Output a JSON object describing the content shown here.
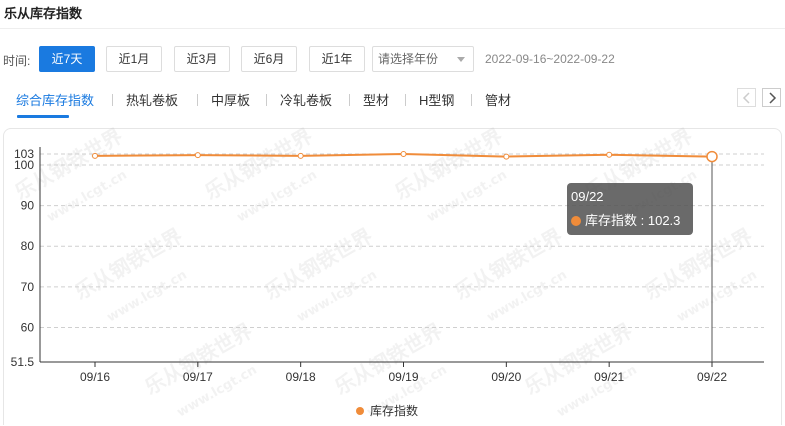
{
  "header": {
    "title": "乐从库存指数"
  },
  "time_filter": {
    "label": "时间:",
    "buttons": [
      "近7天",
      "近1月",
      "近3月",
      "近6月",
      "近1年"
    ],
    "active_index": 0,
    "year_placeholder": "请选择年份",
    "date_range": "2022-09-16~2022-09-22"
  },
  "tabs": {
    "items": [
      "综合库存指数",
      "热轧卷板",
      "中厚板",
      "冷轧卷板",
      "型材",
      "H型钢",
      "管材"
    ],
    "active_index": 0
  },
  "watermark": {
    "text": "乐从钢铁世界",
    "url": "www.lcgt.cn"
  },
  "tooltip": {
    "date": "09/22",
    "series": "库存指数",
    "value": "102.3"
  },
  "colors": {
    "accent": "#1a7ae0",
    "series": "#f08c3a"
  },
  "chart_data": {
    "type": "line",
    "categories": [
      "09/16",
      "09/17",
      "09/18",
      "09/19",
      "09/20",
      "09/21",
      "09/22"
    ],
    "series": [
      {
        "name": "库存指数",
        "values": [
          102.5,
          102.7,
          102.5,
          103.0,
          102.3,
          102.8,
          102.3
        ]
      }
    ],
    "y_ticks": [
      51.5,
      60,
      70,
      80,
      90,
      100,
      103
    ],
    "ylim": [
      51.5,
      103
    ],
    "grid": "horizontal dashed",
    "legend_position": "bottom-center",
    "highlighted_category": "09/22"
  }
}
